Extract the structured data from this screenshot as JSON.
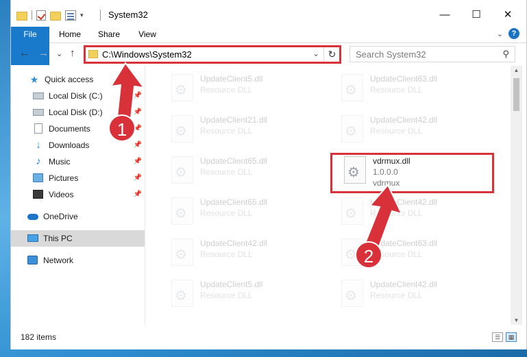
{
  "window": {
    "title": "System32",
    "controls": {
      "minimize": "—",
      "maximize": "☐",
      "close": "✕"
    }
  },
  "ribbon": {
    "tabs": [
      "File",
      "Home",
      "Share",
      "View"
    ],
    "help": "?"
  },
  "nav": {
    "back": "←",
    "forward": "→",
    "recent": "⌄",
    "up": "↑",
    "address": "C:\\Windows\\System32",
    "address_dropdown": "⌄",
    "refresh": "↻",
    "search_placeholder": "Search System32",
    "search_icon": "⚲"
  },
  "sidebar": {
    "items": [
      {
        "label": "Quick access",
        "icon": "star-icon",
        "pinned": false
      },
      {
        "label": "Local Disk (C:)",
        "icon": "drive-icon",
        "pinned": true
      },
      {
        "label": "Local Disk (D:)",
        "icon": "drive-icon",
        "pinned": true
      },
      {
        "label": "Documents",
        "icon": "document-icon",
        "pinned": true
      },
      {
        "label": "Downloads",
        "icon": "download-icon",
        "pinned": true
      },
      {
        "label": "Music",
        "icon": "music-icon",
        "pinned": true
      },
      {
        "label": "Pictures",
        "icon": "pictures-icon",
        "pinned": true
      },
      {
        "label": "Videos",
        "icon": "videos-icon",
        "pinned": true
      },
      {
        "label": "OneDrive",
        "icon": "cloud-icon",
        "pinned": false
      },
      {
        "label": "This PC",
        "icon": "computer-icon",
        "pinned": false,
        "selected": true
      },
      {
        "label": "Network",
        "icon": "network-icon",
        "pinned": false
      }
    ]
  },
  "files": {
    "left": [
      {
        "name": "UpdateClient5.dll",
        "type": "Resource DLL"
      },
      {
        "name": "UpdateClient21.dll",
        "type": "Resource DLL"
      },
      {
        "name": "UpdateClient65.dll",
        "type": "Resource DLL"
      },
      {
        "name": "UpdateClient65.dll",
        "type": "Resource DLL"
      },
      {
        "name": "UpdateClient42.dll",
        "type": "Resource DLL"
      },
      {
        "name": "UpdateClient5.dll",
        "type": "Resource DLL"
      }
    ],
    "right": [
      {
        "name": "UpdateClient63.dll",
        "type": "Resource DLL"
      },
      {
        "name": "UpdateClient42.dll",
        "type": "Resource DLL"
      },
      {
        "name": "vdrmux.dll",
        "version": "1.0.0.0",
        "type": "vdrmux",
        "highlighted": true
      },
      {
        "name": "UpdateClient42.dll",
        "type": "Resource DLL"
      },
      {
        "name": "UpdateClient63.dll",
        "type": "Resource DLL"
      },
      {
        "name": "UpdateClient42.dll",
        "type": "Resource DLL"
      }
    ]
  },
  "status": {
    "item_count": "182 items"
  },
  "annotations": {
    "badge1": "1",
    "badge2": "2",
    "color": "#d9313a"
  }
}
